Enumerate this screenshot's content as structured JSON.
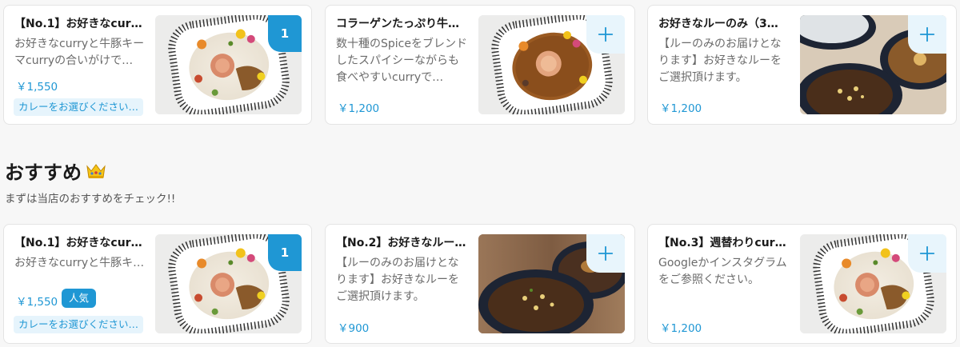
{
  "top_row": [
    {
      "title": "【No.1】お好きなcurr…",
      "desc": "お好きなcurryと牛豚キーマcurryの合いがけで…",
      "price": "￥1,550",
      "tag": "カレーをお選びください…",
      "qty": "1"
    },
    {
      "title": "コラーゲンたっぷり牛…",
      "desc": "数十種のSpiceをブレンドしたスパイシーながらも食べやすいcurryで…",
      "price": "￥1,200"
    },
    {
      "title": "お好きなルーのみ（3…",
      "desc": "【ルーのみのお届けとなります】お好きなルーをご選択頂けます。",
      "price": "￥1,200"
    }
  ],
  "section": {
    "title": "おすすめ",
    "subtitle": "まずは当店のおすすめをチェック!!"
  },
  "bottom_row": [
    {
      "title": "【No.1】お好きなcurr…",
      "desc": "お好きなcurryと牛豚キ…",
      "price": "￥1,550",
      "badge": "人気",
      "tag": "カレーをお選びください…",
      "qty": "1"
    },
    {
      "title": "【No.2】お好きなルー…",
      "desc": "【ルーのみのお届けとなります】お好きなルーをご選択頂けます。",
      "price": "￥900"
    },
    {
      "title": "【No.3】週替わりcurr…",
      "desc": "Googleかインスタグラムをご参照ください。",
      "price": "￥1,200"
    }
  ],
  "icons": {
    "add": "plus-icon",
    "crown": "crown-icon"
  },
  "colors": {
    "accent": "#1f97d4",
    "accent_light": "#e6f4fc"
  }
}
